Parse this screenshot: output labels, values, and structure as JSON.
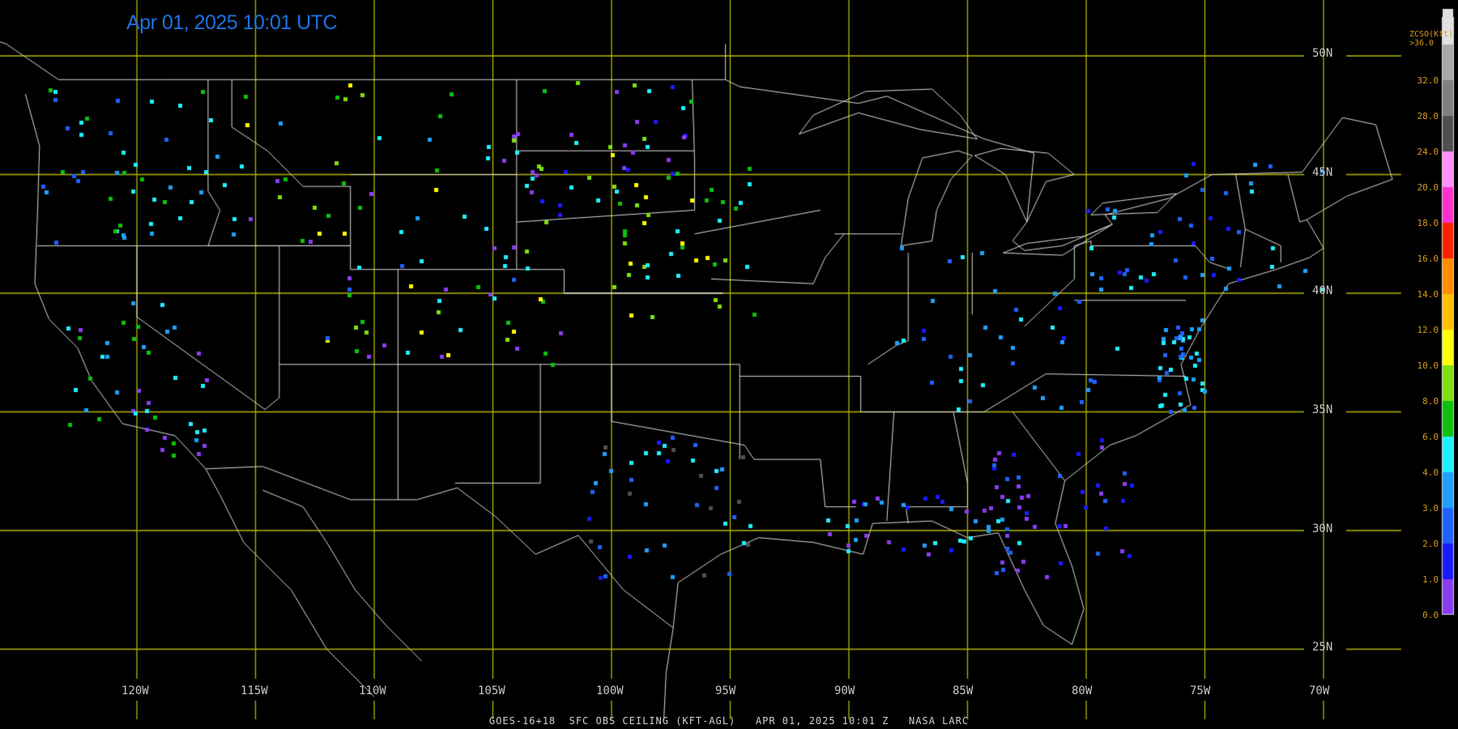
{
  "header": {
    "timestamp": "Apr 01, 2025 10:01 UTC"
  },
  "footer": {
    "caption": "GOES-16+18  SFC OBS CEILING (KFT-AGL)   APR 01, 2025 10:01 Z   NASA LARC"
  },
  "latitudes": [
    "50N",
    "45N",
    "40N",
    "35N",
    "30N",
    "25N"
  ],
  "longitudes": [
    "120W",
    "115W",
    "110W",
    "105W",
    "100W",
    "95W",
    "90W",
    "85W",
    "80W",
    "75W",
    "70W"
  ],
  "legend": {
    "title_line1": "ZCSO(Kft)",
    "title_line2": ">36.0",
    "ticks": [
      "32.0",
      "28.0",
      "24.0",
      "20.0",
      "18.0",
      "16.0",
      "14.0",
      "12.0",
      "10.0",
      "8.0",
      "6.0",
      "4.0",
      "3.0",
      "2.0",
      "1.0",
      "0.0"
    ],
    "colors": [
      "#8a3df0",
      "#1a1aff",
      "#1f62ff",
      "#1fa0ff",
      "#1ff0ff",
      "#0ec00e",
      "#7ee00e",
      "#ffff00",
      "#ffc000",
      "#ff8c00",
      "#ff2000",
      "#ff30d0",
      "#ff90ff",
      "#505050",
      "#808080",
      "#a8a8a8",
      "#e0e0e0"
    ]
  },
  "map_colors": {
    "grid": "#b4b400",
    "border": "#d8d8d8"
  }
}
